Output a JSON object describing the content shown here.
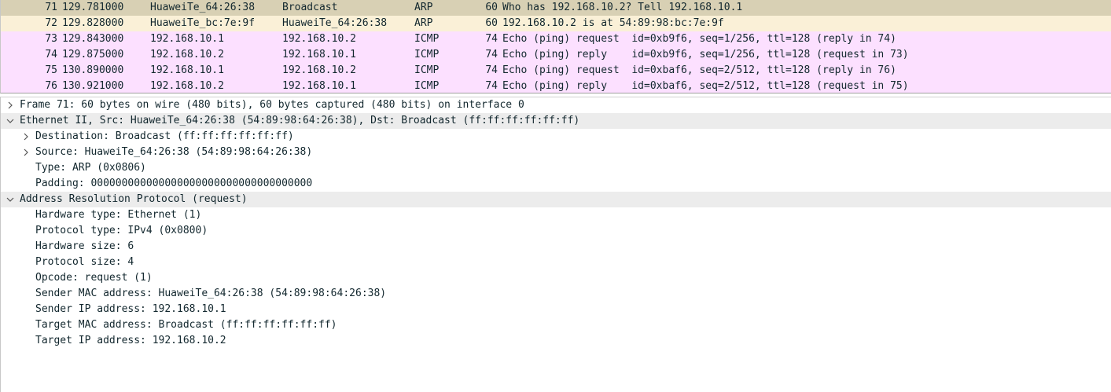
{
  "packets": [
    {
      "no": "71",
      "time": "129.781000",
      "source": "HuaweiTe_64:26:38",
      "destination": "Broadcast",
      "protocol": "ARP",
      "length": "60",
      "info": "Who has 192.168.10.2? Tell 192.168.10.1"
    },
    {
      "no": "72",
      "time": "129.828000",
      "source": "HuaweiTe_bc:7e:9f",
      "destination": "HuaweiTe_64:26:38",
      "protocol": "ARP",
      "length": "60",
      "info": "192.168.10.2 is at 54:89:98:bc:7e:9f"
    },
    {
      "no": "73",
      "time": "129.843000",
      "source": "192.168.10.1",
      "destination": "192.168.10.2",
      "protocol": "ICMP",
      "length": "74",
      "info": "Echo (ping) request  id=0xb9f6, seq=1/256, ttl=128 (reply in 74)"
    },
    {
      "no": "74",
      "time": "129.875000",
      "source": "192.168.10.2",
      "destination": "192.168.10.1",
      "protocol": "ICMP",
      "length": "74",
      "info": "Echo (ping) reply    id=0xb9f6, seq=1/256, ttl=128 (request in 73)"
    },
    {
      "no": "75",
      "time": "130.890000",
      "source": "192.168.10.1",
      "destination": "192.168.10.2",
      "protocol": "ICMP",
      "length": "74",
      "info": "Echo (ping) request  id=0xbaf6, seq=2/512, ttl=128 (reply in 76)"
    },
    {
      "no": "76",
      "time": "130.921000",
      "source": "192.168.10.2",
      "destination": "192.168.10.1",
      "protocol": "ICMP",
      "length": "74",
      "info": "Echo (ping) reply    id=0xbaf6, seq=2/512, ttl=128 (request in 75)"
    }
  ],
  "details": [
    {
      "text": "Frame 71: 60 bytes on wire (480 bits), 60 bytes captured (480 bits) on interface 0",
      "level": 0,
      "arrow": "right",
      "header": false
    },
    {
      "text": "Ethernet II, Src: HuaweiTe_64:26:38 (54:89:98:64:26:38), Dst: Broadcast (ff:ff:ff:ff:ff:ff)",
      "level": 0,
      "arrow": "down",
      "header": true
    },
    {
      "text": "Destination: Broadcast (ff:ff:ff:ff:ff:ff)",
      "level": 1,
      "arrow": "right",
      "header": false
    },
    {
      "text": "Source: HuaweiTe_64:26:38 (54:89:98:64:26:38)",
      "level": 1,
      "arrow": "right",
      "header": false
    },
    {
      "text": "Type: ARP (0x0806)",
      "level": 1,
      "arrow": "none",
      "header": false
    },
    {
      "text": "Padding: 000000000000000000000000000000000000",
      "level": 1,
      "arrow": "none",
      "header": false
    },
    {
      "text": "Address Resolution Protocol (request)",
      "level": 0,
      "arrow": "down",
      "header": true
    },
    {
      "text": "Hardware type: Ethernet (1)",
      "level": 1,
      "arrow": "none",
      "header": false
    },
    {
      "text": "Protocol type: IPv4 (0x0800)",
      "level": 1,
      "arrow": "none",
      "header": false
    },
    {
      "text": "Hardware size: 6",
      "level": 1,
      "arrow": "none",
      "header": false
    },
    {
      "text": "Protocol size: 4",
      "level": 1,
      "arrow": "none",
      "header": false
    },
    {
      "text": "Opcode: request (1)",
      "level": 1,
      "arrow": "none",
      "header": false
    },
    {
      "text": "Sender MAC address: HuaweiTe_64:26:38 (54:89:98:64:26:38)",
      "level": 1,
      "arrow": "none",
      "header": false
    },
    {
      "text": "Sender IP address: 192.168.10.1",
      "level": 1,
      "arrow": "none",
      "header": false
    },
    {
      "text": "Target MAC address: Broadcast (ff:ff:ff:ff:ff:ff)",
      "level": 1,
      "arrow": "none",
      "header": false
    },
    {
      "text": "Target IP address: 192.168.10.2",
      "level": 1,
      "arrow": "none",
      "header": false
    }
  ],
  "colors": {
    "arp_row": "#faf0d7",
    "icmp_row": "#fce0ff",
    "selected_row": "#d8d0b4",
    "tree_header": "#ececec"
  }
}
